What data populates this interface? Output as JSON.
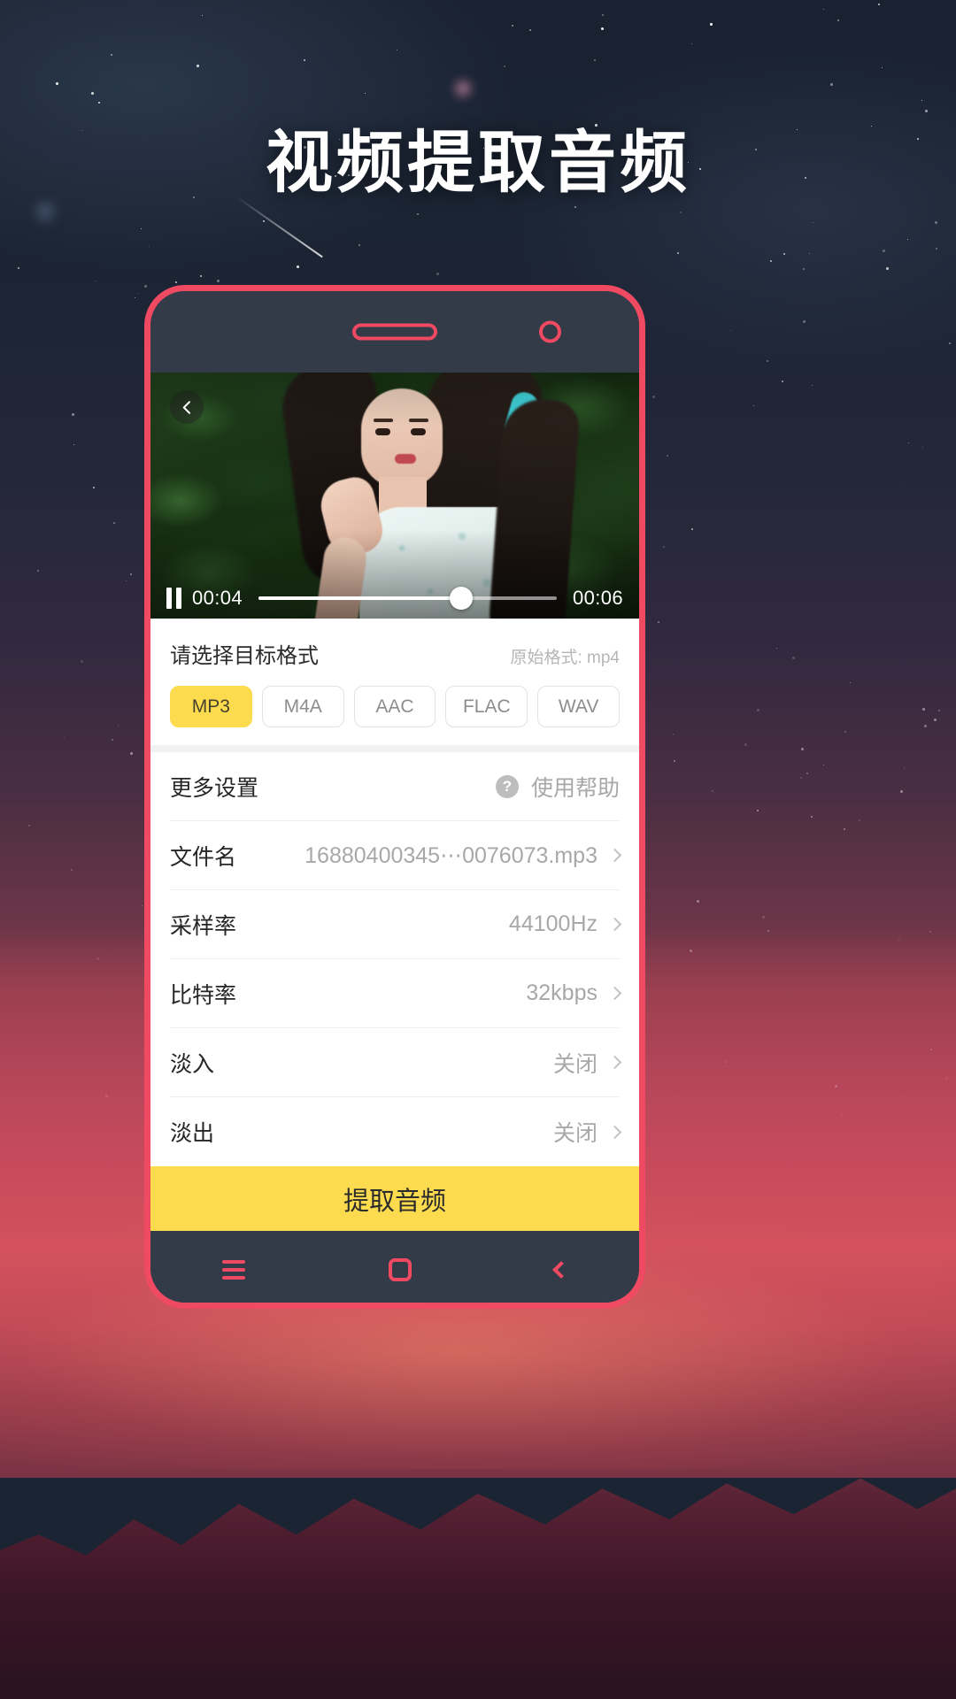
{
  "page": {
    "title": "视频提取音频"
  },
  "phone": {
    "speaker_icon": "speaker-grill",
    "camera_icon": "front-camera"
  },
  "video": {
    "back_icon": "chevron-left-icon",
    "play_state_icon": "pause-icon",
    "current_time": "00:04",
    "duration": "00:06",
    "progress_percent": 68
  },
  "format_section": {
    "title": "请选择目标格式",
    "source_format": "原始格式: mp4",
    "options": [
      {
        "label": "MP3",
        "selected": true
      },
      {
        "label": "M4A",
        "selected": false
      },
      {
        "label": "AAC",
        "selected": false
      },
      {
        "label": "FLAC",
        "selected": false
      },
      {
        "label": "WAV",
        "selected": false
      }
    ]
  },
  "settings": {
    "header": {
      "label": "更多设置",
      "help_icon": "question-mark-icon",
      "help_label": "使用帮助"
    },
    "rows": [
      {
        "label": "文件名",
        "value": "16880400345⋯0076073.mp3"
      },
      {
        "label": "采样率",
        "value": "44100Hz"
      },
      {
        "label": "比特率",
        "value": "32kbps"
      },
      {
        "label": "淡入",
        "value": "关闭"
      },
      {
        "label": "淡出",
        "value": "关闭"
      }
    ]
  },
  "cta": {
    "label": "提取音频"
  },
  "navbar": {
    "items": [
      {
        "icon": "menu-icon"
      },
      {
        "icon": "home-icon"
      },
      {
        "icon": "back-icon"
      }
    ]
  },
  "colors": {
    "accent_yellow": "#fcdb4e",
    "phone_frame": "#ef4a62",
    "phone_body": "#333a48"
  }
}
